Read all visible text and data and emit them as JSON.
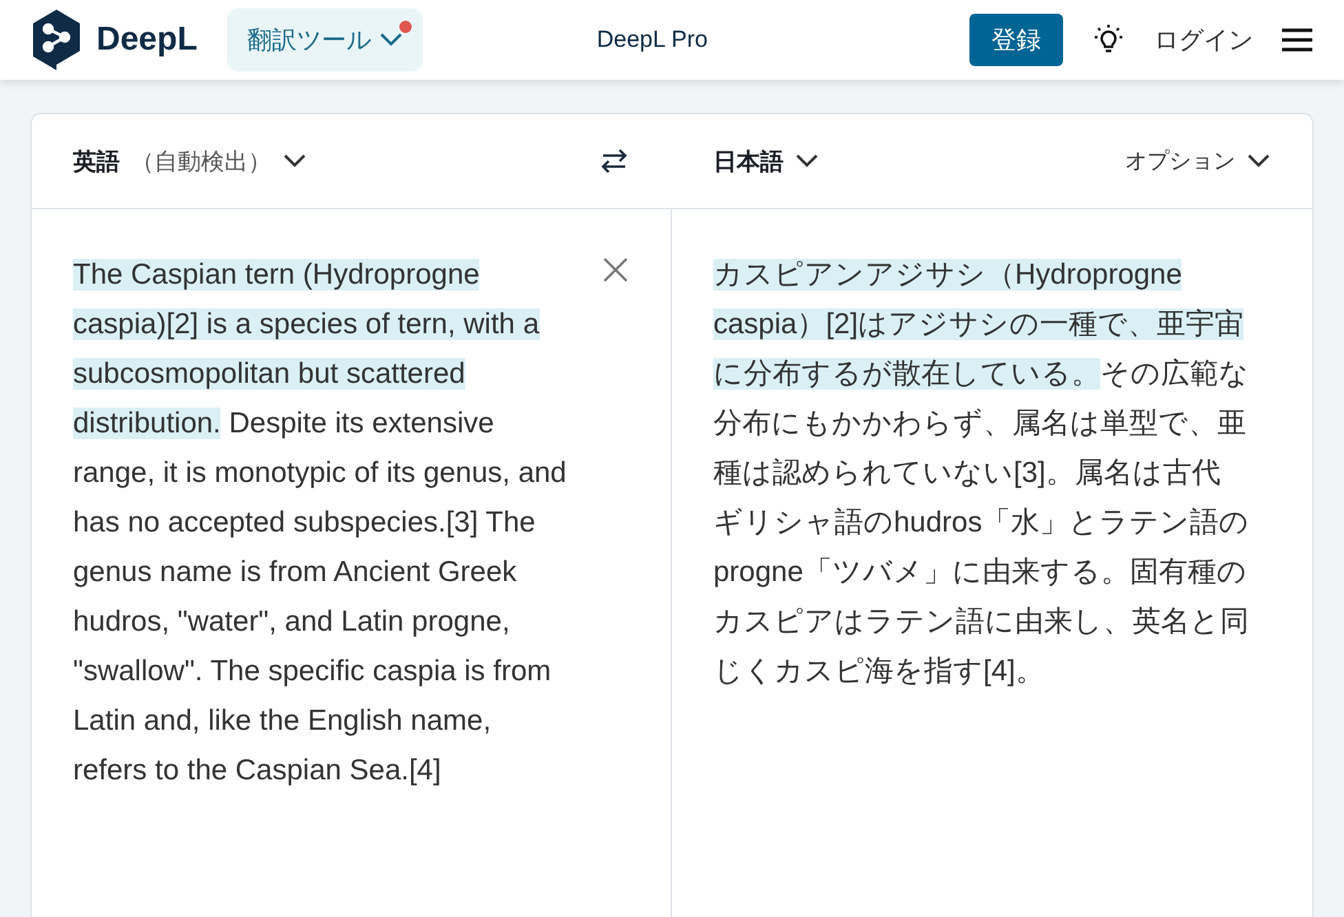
{
  "header": {
    "logo": "DeepL",
    "tool_menu": {
      "label": "翻訳ツール",
      "notification": true
    },
    "pro_link": "DeepL Pro",
    "signup_button": "登録",
    "login_link": "ログイン"
  },
  "language_bar": {
    "source_language": "英語",
    "source_detect": "（自動検出）",
    "target_language": "日本語",
    "options": "オプション"
  },
  "source": {
    "segments": [
      {
        "text": "The Caspian tern (Hydroprogne caspia)[2] is a species of tern, with a subcosmopolitan but scattered distribution.",
        "highlighted": true
      },
      {
        "text": " Despite its extensive range, it is monotypic of its genus, and has no accepted subspecies.[3] The genus name is from Ancient Greek hudros, \"water\", and Latin progne, \"swallow\". The specific caspia is from Latin and, like the English name, refers to the Caspian Sea.[4]",
        "highlighted": false
      }
    ]
  },
  "target": {
    "segments": [
      {
        "text": "カスピアンアジサシ（Hydroprogne caspia）[2]はアジサシの一種で、亜宇宙に分布するが散在している。",
        "highlighted": true
      },
      {
        "text": "その広範な分布にもかかわらず、属名は単型で、亜種は認められていない[3]。属名は古代ギリシャ語のhudros「水」とラテン語のprogne「ツバメ」に由来する。固有種のカスピアはラテン語に由来し、英名と同じくカスピ海を指す[4]。",
        "highlighted": false
      }
    ]
  }
}
